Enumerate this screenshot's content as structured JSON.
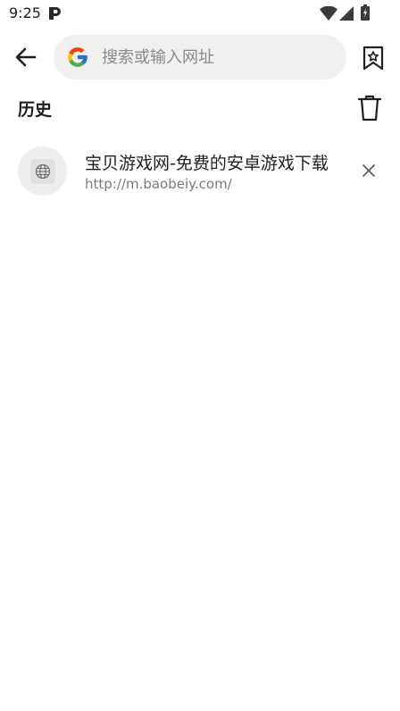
{
  "status_bar": {
    "time": "9:25",
    "icons": [
      "parking-app-icon",
      "wifi-icon",
      "signal-icon",
      "battery-icon"
    ]
  },
  "toolbar": {
    "search_placeholder": "搜索或输入网址",
    "search_value": ""
  },
  "history": {
    "title": "历史",
    "items": [
      {
        "title": "宝贝游戏网-免费的安卓游戏下载",
        "url": "http://m.baobeiy.com/"
      }
    ]
  }
}
